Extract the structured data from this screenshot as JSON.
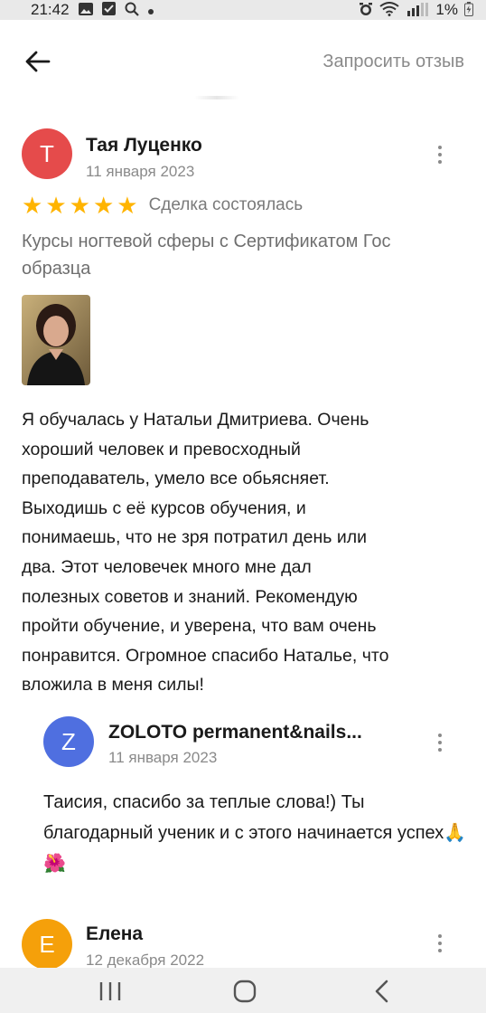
{
  "status_bar": {
    "time": "21:42",
    "left_icons": [
      "gallery-icon",
      "checkbox-icon",
      "search-icon",
      "dot-icon"
    ],
    "right_icons": [
      "alarm-icon",
      "wifi-icon",
      "signal-icon"
    ],
    "battery": "1%"
  },
  "header": {
    "back_icon": "arrow-left-icon",
    "request_review_label": "Запросить отзыв"
  },
  "reviews": [
    {
      "avatar_letter": "Т",
      "avatar_color": "#e54b4b",
      "author": "Тая Луценко",
      "date": "11 января 2023",
      "rating": 5,
      "deal_status": "Сделка состоялась",
      "ad_title": "Курсы ногтевой сферы с Сертификатом Гос образца",
      "text": "Я обучалась у Натальи Дмитриева. Очень\nхороший человек и превосходный\nпреподаватель,  умело все обьясняет.\nВыходишь с её курсов обучения, и\nпонимаешь, что не зря потратил день или\nдва. Этот человечек  много мне дал\nполезных советов и знаний.   Рекомендую\nпройти обучение, и уверена, что вам очень\nпонравится.  Огромное спасибо Натальe, что\nвложила в меня силы!",
      "reply": {
        "avatar_letter": "Z",
        "avatar_color": "#4f6fe0",
        "author": "ZOLOTO permanent&nails...",
        "date": "11 января 2023",
        "text": "Таисия, спасибо за теплые слова!) Ты благодарный ученик и с этого начинается успех🙏🌺"
      }
    },
    {
      "avatar_letter": "Е",
      "avatar_color": "#f5a00a",
      "author": "Елена",
      "date": "12 декабря 2022"
    }
  ],
  "nav_bar": {
    "recents_icon": "recents-icon",
    "home_icon": "home-icon",
    "back_icon": "nav-back-icon"
  }
}
